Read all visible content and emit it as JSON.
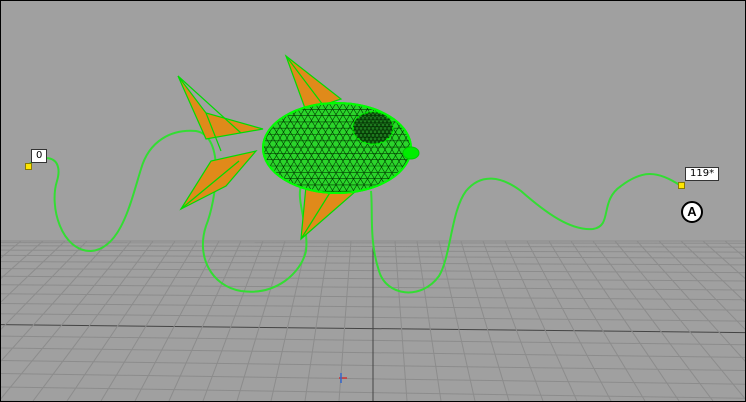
{
  "viewport": {
    "background": "#a0a0a0",
    "grid_color": "#8a8a8a",
    "grid_major_color": "#444444"
  },
  "motion_path": {
    "color": "#33dd33",
    "start_frame": "0",
    "end_frame": "119*",
    "keyframe_color": "#ffe600"
  },
  "fish": {
    "wire_color": "#00ee00",
    "fin_color": "#e08a1a"
  },
  "annotation": {
    "label": "A"
  }
}
